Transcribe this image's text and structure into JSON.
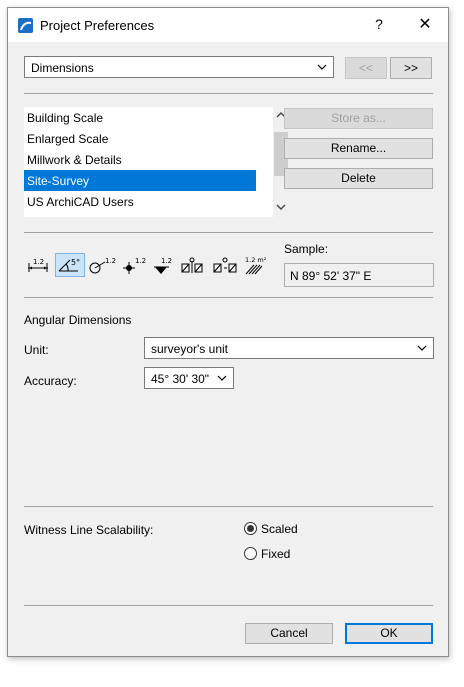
{
  "window": {
    "title": "Project Preferences",
    "help": "?",
    "close": "✕"
  },
  "page_select": {
    "value": "Dimensions"
  },
  "nav": {
    "prev": "<<",
    "next": ">>"
  },
  "standards": {
    "items": [
      "Building Scale",
      "Enlarged Scale",
      "Millwork & Details",
      "Site-Survey",
      "US ArchiCAD Users"
    ],
    "selected_index": 3
  },
  "actions": {
    "store_as": "Store as...",
    "rename": "Rename...",
    "delete": "Delete"
  },
  "tools": [
    {
      "name": "linear-dimension-icon",
      "label": "1.2"
    },
    {
      "name": "angular-dimension-icon",
      "label": "5°"
    },
    {
      "name": "radial-dimension-icon",
      "label": "1.2"
    },
    {
      "name": "level-dimension-icon",
      "label": "1.2"
    },
    {
      "name": "elevation-dimension-icon",
      "label": "1.2"
    },
    {
      "name": "door-window-dimension-icon",
      "label": ""
    },
    {
      "name": "sill-height-dimension-icon",
      "label": ""
    },
    {
      "name": "area-calculation-icon",
      "label": "1.2 m²"
    }
  ],
  "sample": {
    "label": "Sample:",
    "value": "N 89° 52' 37\" E"
  },
  "angular": {
    "heading": "Angular Dimensions",
    "unit_label": "Unit:",
    "unit_value": "surveyor's unit",
    "accuracy_label": "Accuracy:",
    "accuracy_value": "45° 30' 30\""
  },
  "witness": {
    "label": "Witness Line Scalability:",
    "options": [
      "Scaled",
      "Fixed"
    ],
    "selected": "Scaled"
  },
  "footer": {
    "cancel": "Cancel",
    "ok": "OK"
  },
  "colors": {
    "selection": "#0078d7",
    "active_tool": "#cce4f7",
    "dialog_bg": "#f0f0f0"
  }
}
